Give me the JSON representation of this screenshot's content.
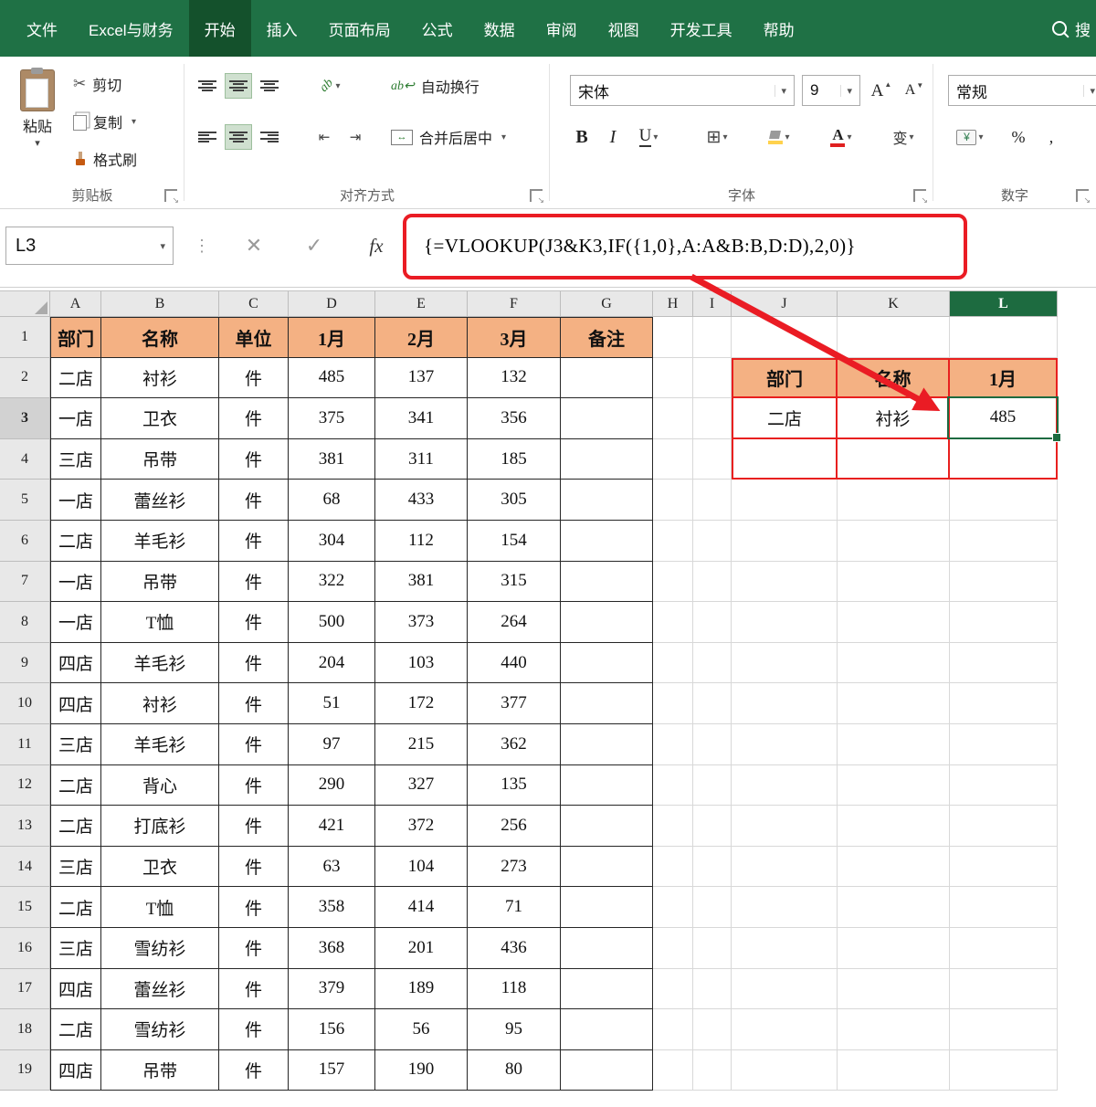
{
  "tabs": [
    {
      "label": "文件",
      "active": false
    },
    {
      "label": "Excel与财务",
      "active": false
    },
    {
      "label": "开始",
      "active": true
    },
    {
      "label": "插入",
      "active": false
    },
    {
      "label": "页面布局",
      "active": false
    },
    {
      "label": "公式",
      "active": false
    },
    {
      "label": "数据",
      "active": false
    },
    {
      "label": "审阅",
      "active": false
    },
    {
      "label": "视图",
      "active": false
    },
    {
      "label": "开发工具",
      "active": false
    },
    {
      "label": "帮助",
      "active": false
    }
  ],
  "search_label": "搜",
  "ribbon": {
    "clipboard": {
      "label": "剪贴板",
      "paste": "粘贴",
      "cut": "剪切",
      "copy": "复制",
      "format_painter": "格式刷"
    },
    "alignment": {
      "label": "对齐方式",
      "wrap_text": "自动换行",
      "merge_center": "合并后居中"
    },
    "font": {
      "label": "字体",
      "font_name": "宋体",
      "font_size": "9",
      "bold": "B",
      "italic": "I",
      "underline": "U",
      "phonetic_glyph": "变"
    },
    "number": {
      "label": "数字",
      "format": "常规",
      "percent": "%",
      "comma": ","
    }
  },
  "formula_bar": {
    "name_box": "L3",
    "cancel_glyph": "✕",
    "enter_glyph": "✓",
    "fx_label": "fx",
    "formula": "{=VLOOKUP(J3&K3,IF({1,0},A:A&B:B,D:D),2,0)}"
  },
  "grid": {
    "columns": [
      "A",
      "B",
      "C",
      "D",
      "E",
      "F",
      "G",
      "H",
      "I",
      "J",
      "K",
      "L"
    ],
    "selected_cell": "L3",
    "row_count": 19
  },
  "main_table": {
    "headers": [
      "部门",
      "名称",
      "单位",
      "1月",
      "2月",
      "3月",
      "备注"
    ],
    "rows": [
      [
        "二店",
        "衬衫",
        "件",
        "485",
        "137",
        "132"
      ],
      [
        "一店",
        "卫衣",
        "件",
        "375",
        "341",
        "356"
      ],
      [
        "三店",
        "吊带",
        "件",
        "381",
        "311",
        "185"
      ],
      [
        "一店",
        "蕾丝衫",
        "件",
        "68",
        "433",
        "305"
      ],
      [
        "二店",
        "羊毛衫",
        "件",
        "304",
        "112",
        "154"
      ],
      [
        "一店",
        "吊带",
        "件",
        "322",
        "381",
        "315"
      ],
      [
        "一店",
        "T恤",
        "件",
        "500",
        "373",
        "264"
      ],
      [
        "四店",
        "羊毛衫",
        "件",
        "204",
        "103",
        "440"
      ],
      [
        "四店",
        "衬衫",
        "件",
        "51",
        "172",
        "377"
      ],
      [
        "三店",
        "羊毛衫",
        "件",
        "97",
        "215",
        "362"
      ],
      [
        "二店",
        "背心",
        "件",
        "290",
        "327",
        "135"
      ],
      [
        "二店",
        "打底衫",
        "件",
        "421",
        "372",
        "256"
      ],
      [
        "三店",
        "卫衣",
        "件",
        "63",
        "104",
        "273"
      ],
      [
        "二店",
        "T恤",
        "件",
        "358",
        "414",
        "71"
      ],
      [
        "三店",
        "雪纺衫",
        "件",
        "368",
        "201",
        "436"
      ],
      [
        "四店",
        "蕾丝衫",
        "件",
        "379",
        "189",
        "118"
      ],
      [
        "二店",
        "雪纺衫",
        "件",
        "156",
        "56",
        "95"
      ],
      [
        "四店",
        "吊带",
        "件",
        "157",
        "190",
        "80"
      ]
    ]
  },
  "lookup_table": {
    "headers": [
      "部门",
      "名称",
      "1月"
    ],
    "values": [
      "二店",
      "衬衫",
      "485"
    ]
  },
  "colors": {
    "ribbon_green": "#1f7145",
    "active_tab_green": "#14512c",
    "table_header_fill": "#f4b183",
    "annotation_red": "#ea1c24",
    "selection_green": "#1d6b40"
  }
}
